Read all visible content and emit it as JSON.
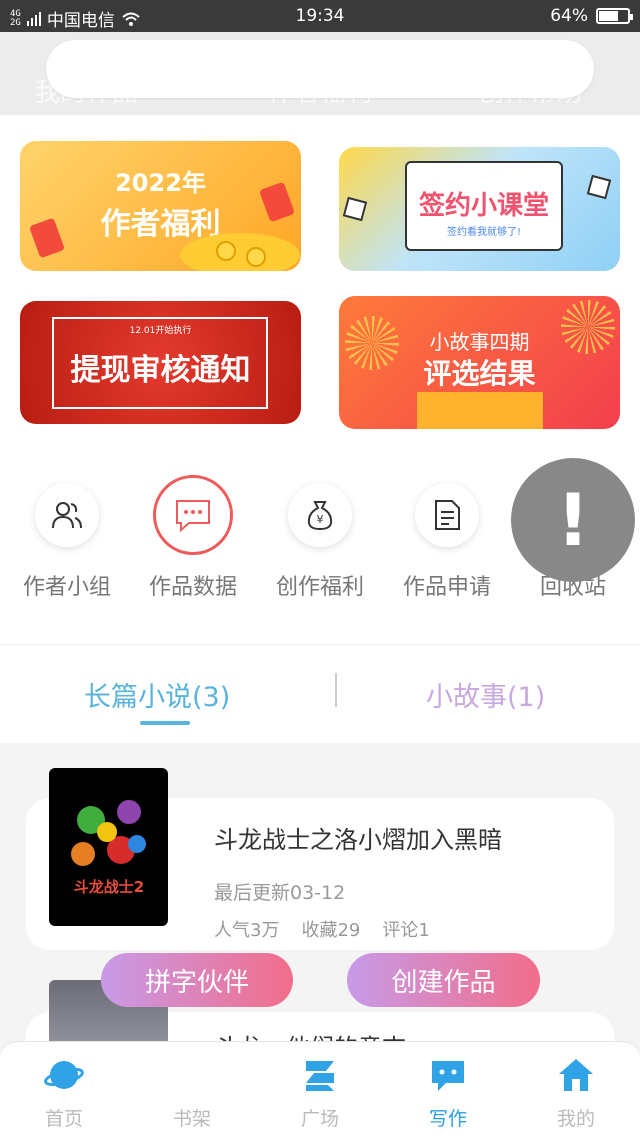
{
  "status_bar": {
    "network": "4G",
    "network2": "2G",
    "carrier": "中国电信",
    "time": "19:34",
    "battery": "64%",
    "battery_level": 0.64
  },
  "header": {
    "tabs": [
      "我的作品",
      "作者福利",
      "创作帮助"
    ]
  },
  "banners": {
    "welfare": {
      "year": "2022年",
      "title": "作者福利"
    },
    "contract": {
      "title": "签约小课堂",
      "subtitle": "签约看我就够了!"
    },
    "withdraw": {
      "small": "12.01开始执行",
      "title": "提现审核通知"
    },
    "story": {
      "line1": "小故事四期",
      "line2": "评选结果"
    }
  },
  "menu": {
    "items": [
      {
        "label": "作者小组",
        "icon": "users-icon"
      },
      {
        "label": "作品数据",
        "icon": "chat-icon"
      },
      {
        "label": "创作福利",
        "icon": "money-bag-icon"
      },
      {
        "label": "作品申请",
        "icon": "document-icon"
      },
      {
        "label": "回收站",
        "icon": "trash-icon"
      }
    ]
  },
  "alert": {
    "glyph": "!"
  },
  "tabs": {
    "long": "长篇小说(3)",
    "short": "小故事(1)"
  },
  "works": [
    {
      "title": "斗龙战士之洛小熠加入黑暗",
      "updated": "最后更新03-12",
      "popularity": "人气3万",
      "favorites": "收藏29",
      "comments": "评论1",
      "cover_text": "斗龙战士2"
    },
    {
      "title": "斗龙…他们的意志"
    }
  ],
  "actions": {
    "partner": "拼字伙伴",
    "create": "创建作品"
  },
  "nav": {
    "items": [
      {
        "label": "首页",
        "icon": "planet-icon"
      },
      {
        "label": "书架",
        "icon": "bookshelf-icon"
      },
      {
        "label": "广场",
        "icon": "square-icon"
      },
      {
        "label": "写作",
        "icon": "write-chat-icon"
      },
      {
        "label": "我的",
        "icon": "home-icon"
      }
    ],
    "active": "写作"
  },
  "colors": {
    "accent": "#5ab3dd",
    "gradient_start": "#c89ae8",
    "gradient_end": "#f26d8a",
    "nav_active": "#2a9fe0"
  }
}
